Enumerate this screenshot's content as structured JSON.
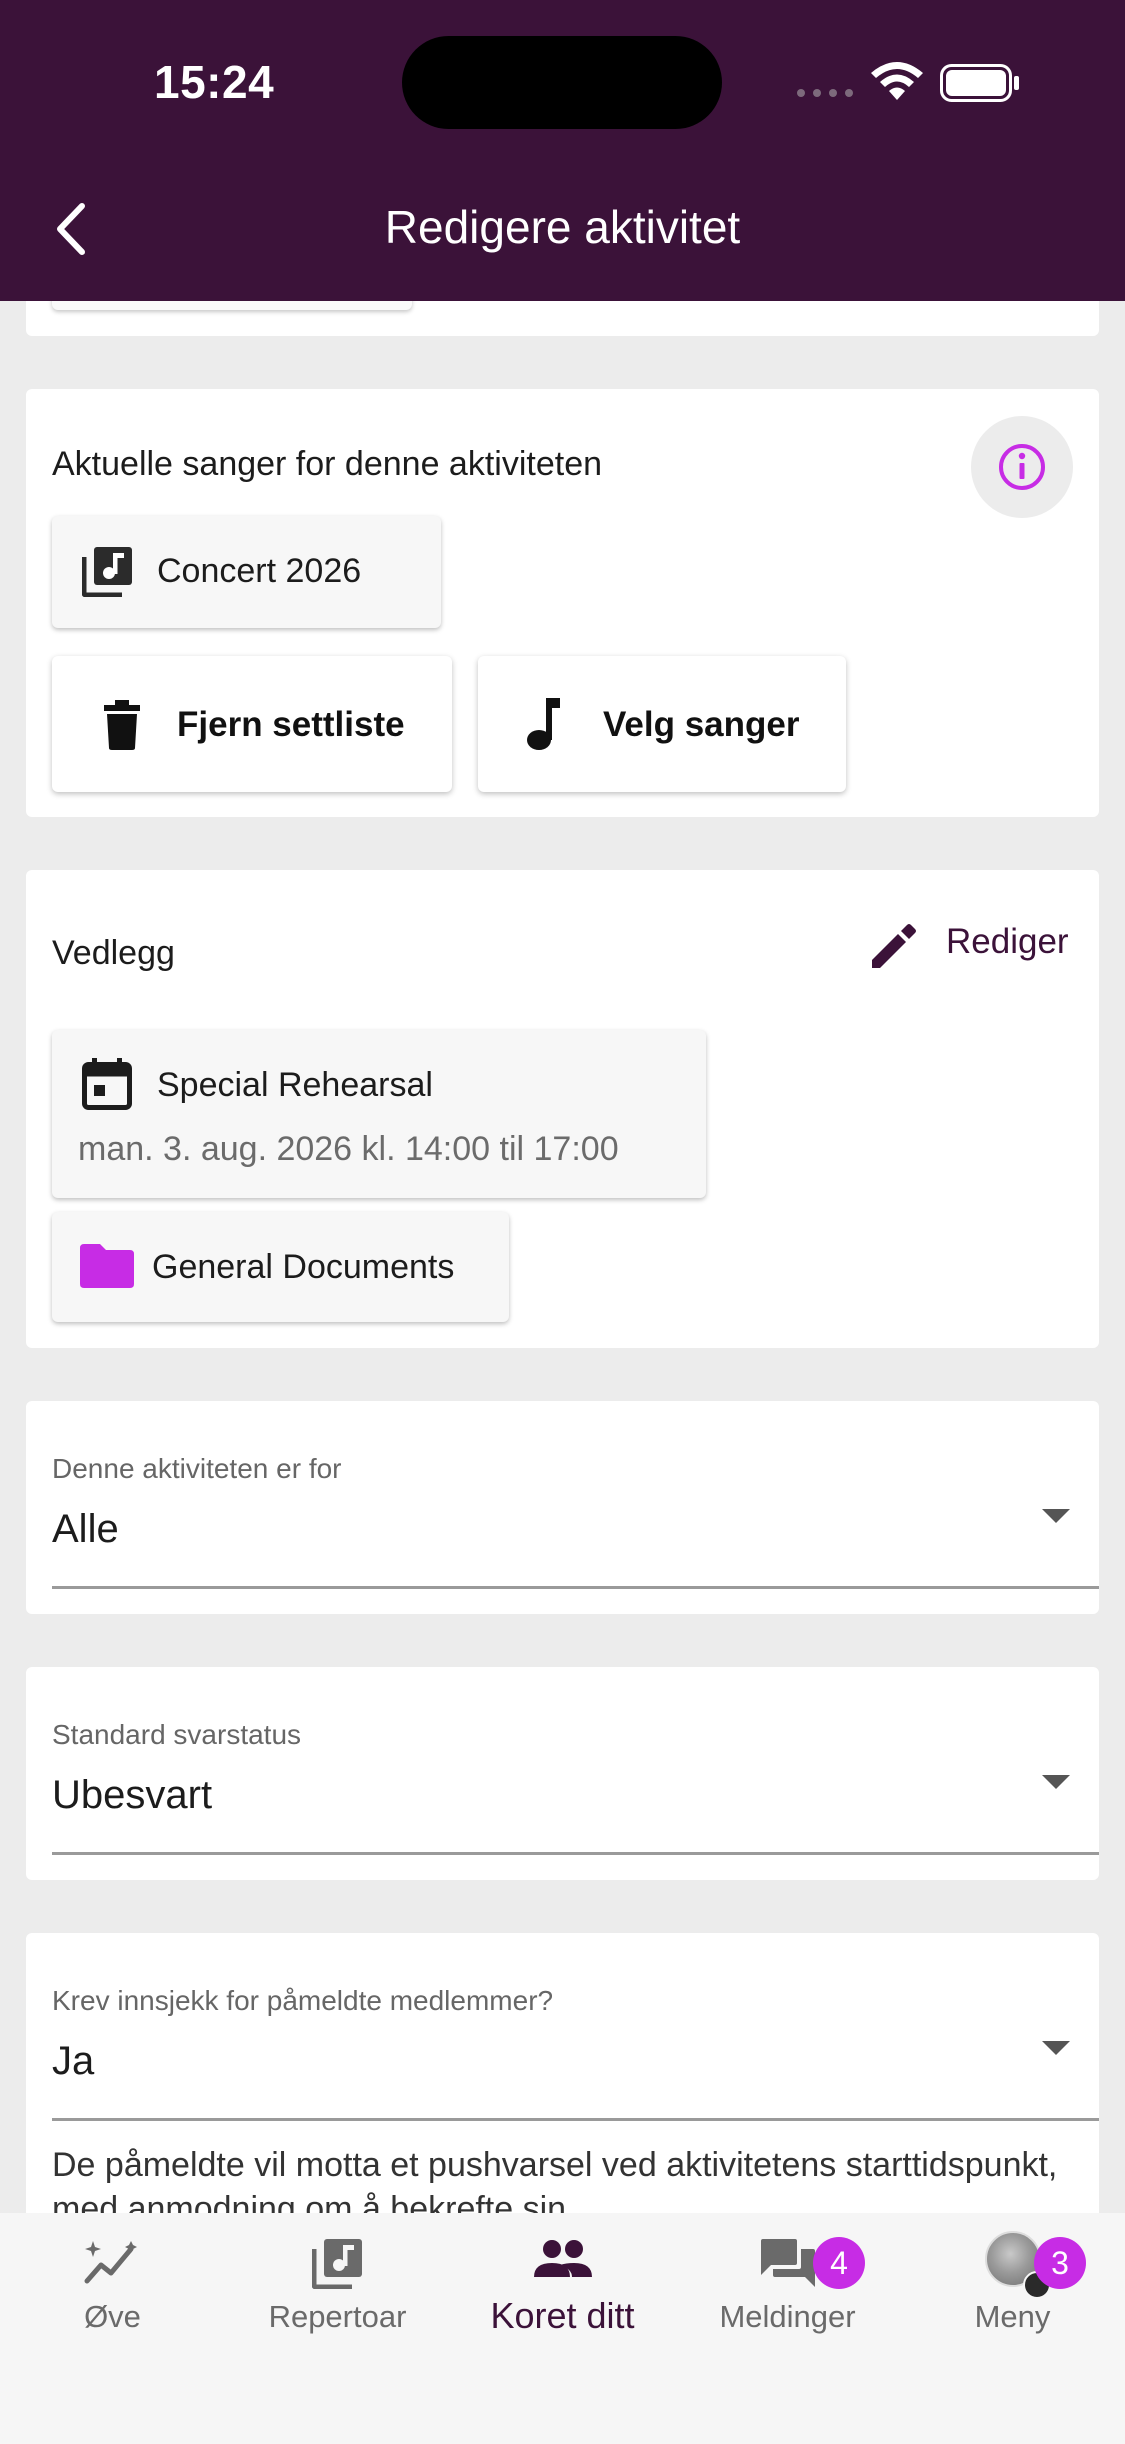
{
  "status_bar": {
    "time": "15:24"
  },
  "header": {
    "title": "Redigere aktivitet"
  },
  "songs": {
    "label": "Aktuelle sanger for denne aktiviteten",
    "setlist_chip": "Concert 2026",
    "remove_button": "Fjern settliste",
    "choose_button": "Velg sanger"
  },
  "attachments": {
    "label": "Vedlegg",
    "edit_label": "Rediger",
    "event_title": "Special Rehearsal",
    "event_time": "man. 3. aug. 2026 kl. 14:00 til 17:00",
    "folder": "General Documents"
  },
  "audience": {
    "label": "Denne aktiviteten er for",
    "value": "Alle"
  },
  "default_status": {
    "label": "Standard svarstatus",
    "value": "Ubesvart"
  },
  "checkin": {
    "label": "Krev innsjekk for påmeldte medlemmer?",
    "value": "Ja",
    "helper": "De påmeldte vil motta et pushvarsel ved aktivitetens starttidspunkt, med anmodning om å bekrefte sin"
  },
  "bottom_nav": {
    "items": [
      {
        "label": "Øve",
        "icon": "chart-sparkle-icon"
      },
      {
        "label": "Repertoar",
        "icon": "music-library-icon"
      },
      {
        "label": "Koret ditt",
        "icon": "group-icon",
        "active": true
      },
      {
        "label": "Meldinger",
        "icon": "chat-icon",
        "badge": "4"
      },
      {
        "label": "Meny",
        "icon": "avatar-icon",
        "badge": "3"
      }
    ]
  },
  "colors": {
    "primary": "#3b1239",
    "accent": "#c72ce5",
    "background": "#ececec"
  }
}
